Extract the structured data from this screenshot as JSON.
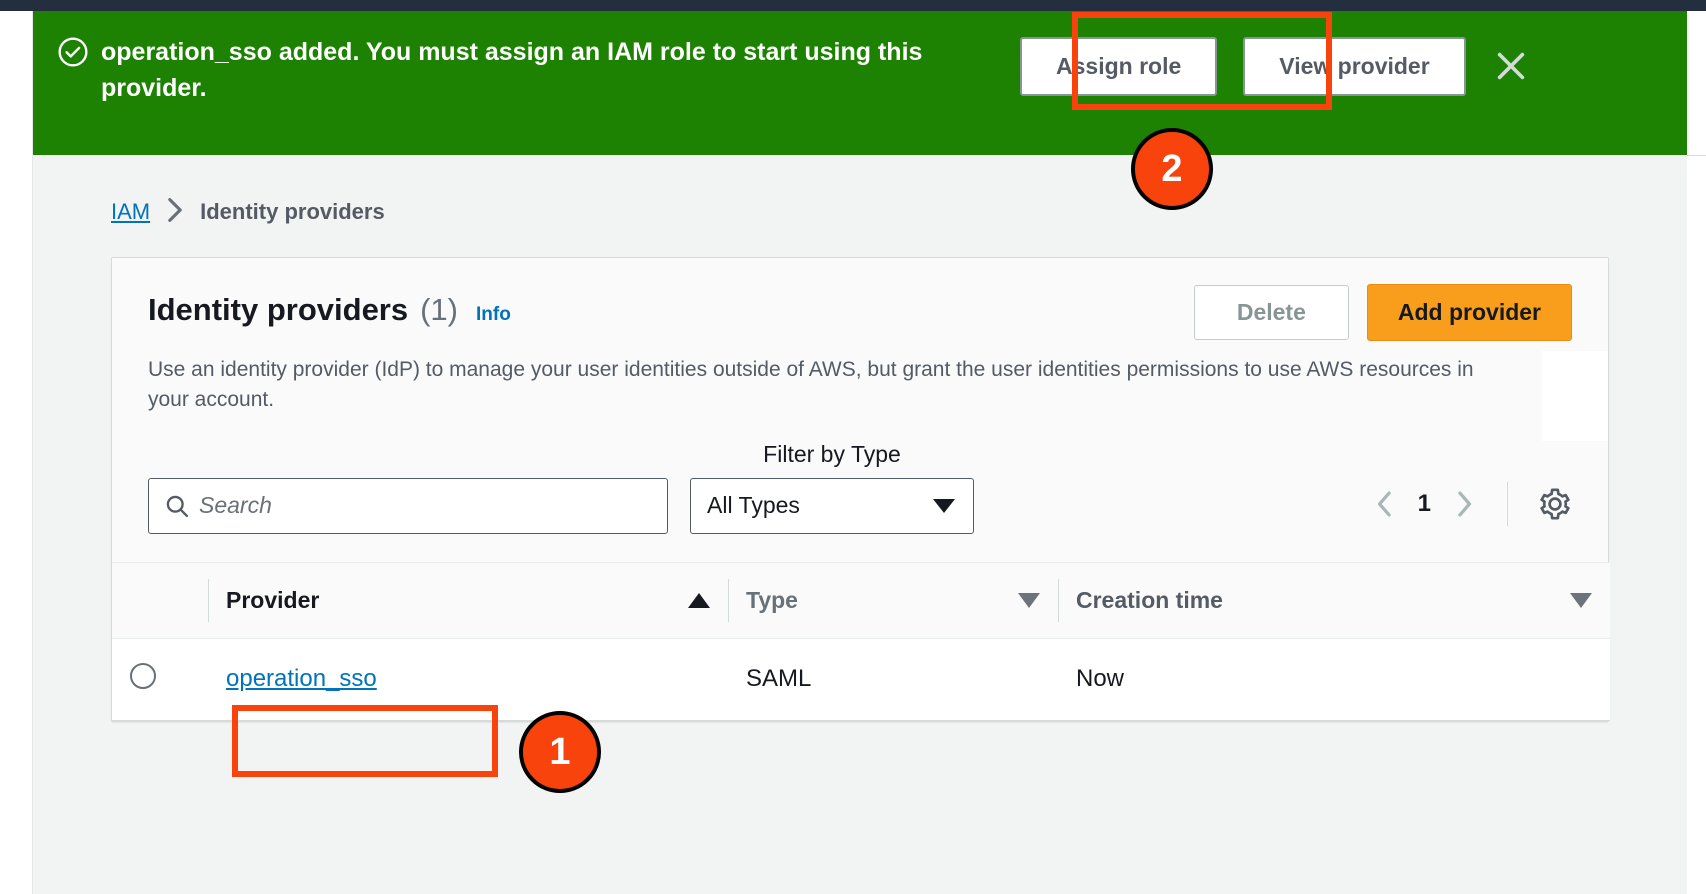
{
  "banner": {
    "icon": "check-circle-icon",
    "message": "operation_sso added. You must assign an IAM role to start using this provider.",
    "assign_role_label": "Assign role",
    "view_provider_label": "View provider",
    "close_icon": "close-icon",
    "background_color": "#1d8102"
  },
  "breadcrumb": {
    "root": "IAM",
    "separator": "›",
    "current": "Identity providers"
  },
  "panel": {
    "title": "Identity providers",
    "count": "(1)",
    "info_label": "Info",
    "delete_label": "Delete",
    "add_provider_label": "Add provider",
    "description": "Use an identity provider (IdP) to manage your user identities outside of AWS, but grant the user identities permissions to use AWS resources in your account."
  },
  "filters": {
    "search_placeholder": "Search",
    "search_value": "",
    "search_icon": "search-icon",
    "type_filter_label": "Filter by Type",
    "type_filter_value": "All Types",
    "type_filter_options": [
      "All Types"
    ],
    "pagination": {
      "prev_icon": "chevron-left-icon",
      "page": "1",
      "next_icon": "chevron-right-icon"
    },
    "settings_icon": "gear-icon"
  },
  "table": {
    "columns": [
      {
        "label": "Provider",
        "sort": "asc",
        "sort_icon": "sort-ascending-icon"
      },
      {
        "label": "Type",
        "sort": "none",
        "sort_icon": "sort-descending-icon"
      },
      {
        "label": "Creation time",
        "sort": "none",
        "sort_icon": "sort-descending-icon"
      }
    ],
    "rows": [
      {
        "selected": false,
        "provider": "operation_sso",
        "type": "SAML",
        "creation_time": "Now"
      }
    ]
  },
  "annotations": {
    "accent_color": "#f8430c",
    "steps": [
      {
        "number": "1",
        "target": "provider-link"
      },
      {
        "number": "2",
        "target": "assign-role-button"
      }
    ]
  }
}
